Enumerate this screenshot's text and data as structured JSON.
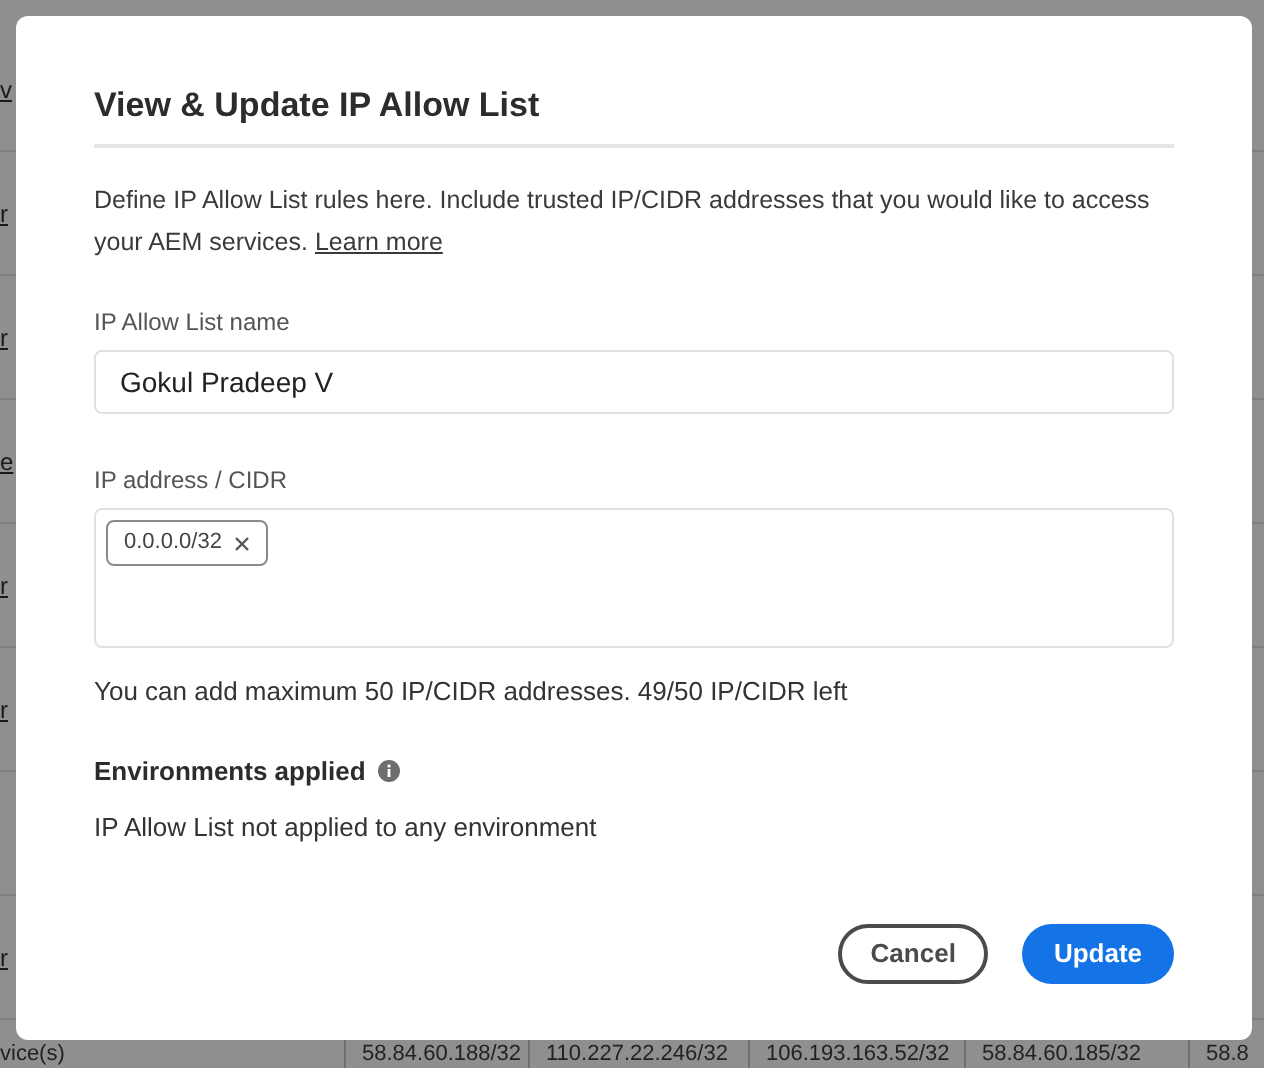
{
  "background_table": {
    "rows": [
      {
        "column_1": "v"
      },
      {
        "column_1": "r"
      },
      {
        "column_1": "r"
      },
      {
        "column_1": "e"
      },
      {
        "column_1": "r"
      },
      {
        "column_1": "r"
      },
      {},
      {
        "column_1": "r"
      }
    ],
    "footer_cells": [
      "vice(s)",
      "58.84.60.188/32",
      "110.227.22.246/32",
      "106.193.163.52/32",
      "58.84.60.185/32",
      "58.8"
    ]
  },
  "dialog": {
    "title": "View & Update IP Allow List",
    "description": "Define IP Allow List rules here. Include trusted IP/CIDR addresses that you would like to access your AEM services.",
    "link": "Learn more",
    "name_field": {
      "label": "IP Allow List name",
      "value": "Gokul Pradeep V"
    },
    "ip_field": {
      "label": "IP address / CIDR",
      "tags": [
        "0.0.0.0/32"
      ]
    },
    "help_text": "You can add maximum 50 IP/CIDR addresses. 49/50 IP/CIDR left",
    "environments": {
      "heading": "Environments applied",
      "text": "IP Allow List not applied to any environment"
    },
    "buttons": [
      {
        "label": "Cancel",
        "kind": "secondary"
      },
      {
        "label": "Update",
        "kind": "primary"
      }
    ]
  }
}
